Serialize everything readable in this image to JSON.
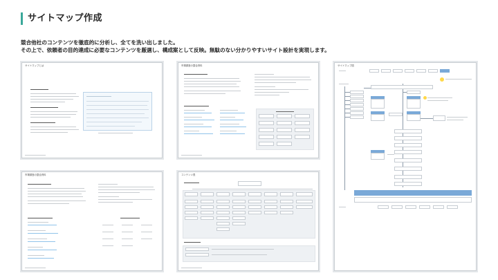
{
  "header": {
    "title": "サイトマップ作成"
  },
  "description": [
    "競合他社のコンテンツを徹底的に分析し、全てを洗い出しました。",
    "その上で、依頼者の目的達成に必要なコンテンツを厳選し、構成案として反映。無駄のない分かりやすいサイト設計を実現します。"
  ],
  "panels": [
    {
      "title": "サイトマップとは"
    },
    {
      "title": "市場調査の整合資料"
    },
    {
      "title": "市場調査の整合資料"
    },
    {
      "title": "コンテンツ表"
    },
    {
      "title": "サイトマップ図"
    }
  ],
  "colors": {
    "accent": "#3aa89a",
    "panel_border": "#c9ced2",
    "diagram_header": "#7aa9d8"
  }
}
